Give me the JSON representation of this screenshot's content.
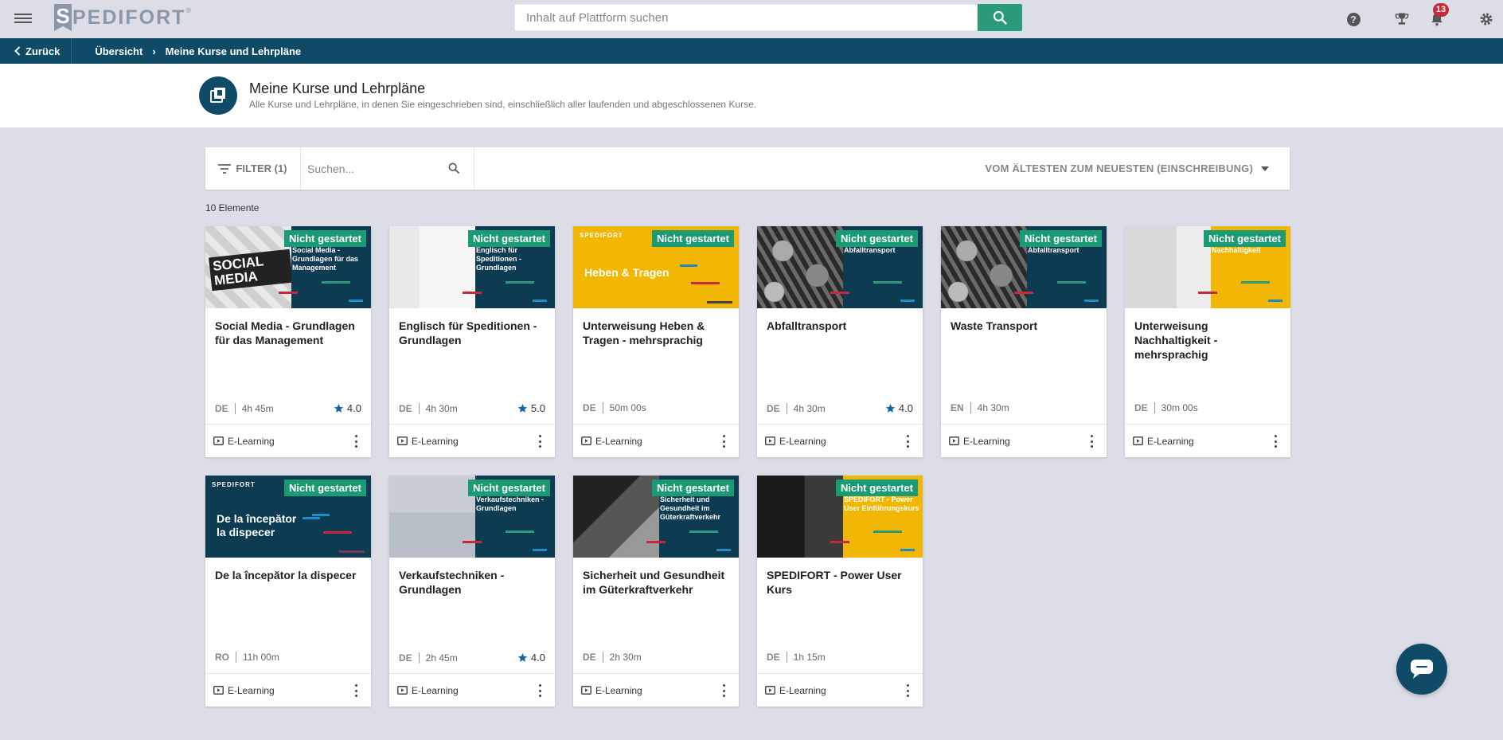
{
  "topbar": {
    "logo_text": "SPEDIFORT",
    "search_placeholder": "Inhalt auf Plattform suchen",
    "notification_count": "13",
    "icons": [
      "menu-icon",
      "help-icon",
      "trophy-icon",
      "bell-icon",
      "gear-icon",
      "search-icon"
    ]
  },
  "breadcrumb": {
    "back_label": "Zurück",
    "items": [
      "Übersicht",
      "Meine Kurse und Lehrpläne"
    ]
  },
  "header": {
    "title": "Meine Kurse und Lehrpläne",
    "subtitle": "Alle Kurse und Lehrpläne, in denen Sie eingeschrieben sind, einschließlich aller laufenden und abgeschlossenen Kurse."
  },
  "filterbar": {
    "filter_label": "FILTER (1)",
    "search_placeholder": "Suchen...",
    "sort_label": "VOM ÄLTESTEN ZUM NEUESTEN (EINSCHREIBUNG)"
  },
  "count_label": "10 Elemente",
  "colors": {
    "accent_green": "#1a9b75",
    "navy": "#0f4a67",
    "thumb_navy": "#0d3b52",
    "thumb_yellow": "#f2b705",
    "bar_red": "#c8283b",
    "bar_teal": "#2b9a7a",
    "bar_blue": "#1e8bc3"
  },
  "cards": [
    {
      "status": "Nicht gestartet",
      "thumb_text": "Social Media - Grundlagen für das Management",
      "title": "Social Media - Grundlagen für das Management",
      "lang": "DE",
      "duration": "4h 45m",
      "rating": "4.0",
      "type": "E-Learning",
      "photo_text": "SOCIAL MEDIA"
    },
    {
      "status": "Nicht gestartet",
      "thumb_text": "Englisch für Speditionen - Grundlagen",
      "title": "Englisch für Speditionen - Grundlagen",
      "lang": "DE",
      "duration": "4h 30m",
      "rating": "5.0",
      "type": "E-Learning"
    },
    {
      "status": "Nicht gestartet",
      "thumb_text": "Heben & Tragen",
      "title": "Unterweisung Heben & Tragen - mehrsprachig",
      "lang": "DE",
      "duration": "50m 00s",
      "rating": "",
      "type": "E-Learning",
      "logo_mini": "SPEDIFORT"
    },
    {
      "status": "Nicht gestartet",
      "thumb_text": "Abfalltransport",
      "title": "Abfalltransport",
      "lang": "DE",
      "duration": "4h 30m",
      "rating": "4.0",
      "type": "E-Learning"
    },
    {
      "status": "Nicht gestartet",
      "thumb_text": "Abfalltransport",
      "title": "Waste Transport",
      "lang": "EN",
      "duration": "4h 30m",
      "rating": "",
      "type": "E-Learning"
    },
    {
      "status": "Nicht gestartet",
      "thumb_text": "Nachhaltigkeit",
      "title": "Unterweisung Nachhaltigkeit - mehrsprachig",
      "lang": "DE",
      "duration": "30m 00s",
      "rating": "",
      "type": "E-Learning"
    },
    {
      "status": "Nicht gestartet",
      "thumb_text": "De la începător la dispecer",
      "title": "De la începător la dispecer",
      "lang": "RO",
      "duration": "11h 00m",
      "rating": "",
      "type": "E-Learning",
      "logo_mini": "SPEDIFORT"
    },
    {
      "status": "Nicht gestartet",
      "thumb_text": "Verkaufstechniken - Grundlagen",
      "title": "Verkaufstechniken - Grundlagen",
      "lang": "DE",
      "duration": "2h 45m",
      "rating": "4.0",
      "type": "E-Learning"
    },
    {
      "status": "Nicht gestartet",
      "thumb_text": "Sicherheit und Gesundheit im Güterkraftverkehr",
      "title": "Sicherheit und Gesundheit im Güterkraftverkehr",
      "lang": "DE",
      "duration": "2h 30m",
      "rating": "",
      "type": "E-Learning"
    },
    {
      "status": "Nicht gestartet",
      "thumb_text": "SPEDIFORT - Power User Einführungskurs",
      "title": "SPEDIFORT - Power User Kurs",
      "lang": "DE",
      "duration": "1h 15m",
      "rating": "",
      "type": "E-Learning"
    }
  ]
}
